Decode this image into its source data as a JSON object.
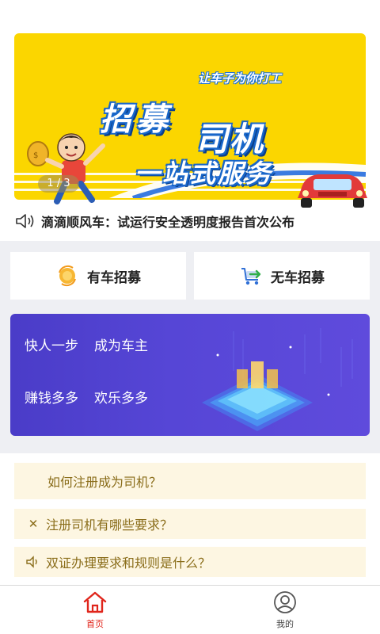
{
  "banner": {
    "slogan": "让车子为你打工",
    "title_line1": "招募",
    "title_line2": "司机",
    "title_line3": "一站式服务",
    "pager": "1 / 3"
  },
  "notice": {
    "icon": "speaker-icon",
    "text": "滴滴顺风车：试运行安全透明度报告首次公布"
  },
  "recruit": {
    "with_car": {
      "label": "有车招募",
      "icon": "coin-refresh-icon"
    },
    "without_car": {
      "label": "无车招募",
      "icon": "cart-arrow-icon"
    }
  },
  "promo": {
    "line1_a": "快人一步",
    "line1_b": "成为车主",
    "line2_a": "赚钱多多",
    "line2_b": "欢乐多多"
  },
  "faq": [
    {
      "icon": "",
      "text": "如何注册成为司机？"
    },
    {
      "icon": "close-icon",
      "text": "注册司机有哪些要求？"
    },
    {
      "icon": "speaker-icon",
      "text": "双证办理要求和规则是什么？"
    }
  ],
  "tabbar": {
    "home": {
      "label": "首页",
      "icon": "home-icon",
      "active": true
    },
    "mine": {
      "label": "我的",
      "icon": "user-icon",
      "active": false
    }
  },
  "colors": {
    "banner_yellow": "#fbd600",
    "title_blue": "#1866c9",
    "promo_purple": "#5646d6",
    "faq_bg": "#fdf6e2",
    "faq_text": "#8a6d1a",
    "active_tab": "#e0251b",
    "inactive_tab": "#555555"
  }
}
